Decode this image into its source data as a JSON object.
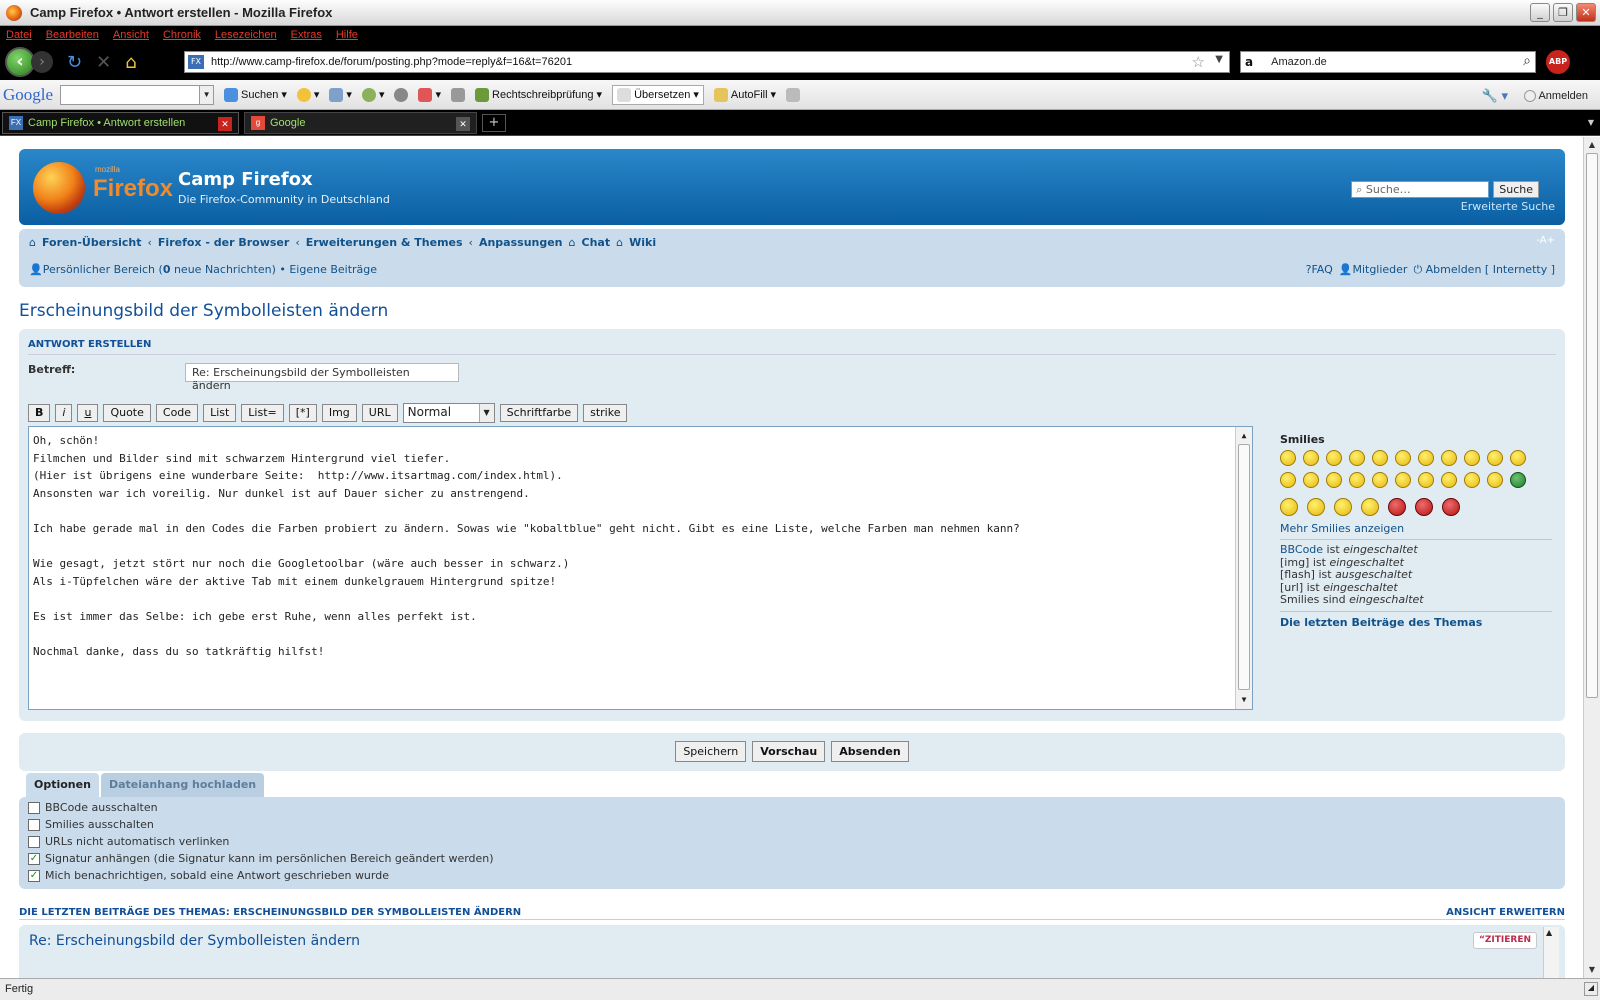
{
  "window": {
    "title": "Camp Firefox • Antwort erstellen - Mozilla Firefox"
  },
  "menu": [
    "Datei",
    "Bearbeiten",
    "Ansicht",
    "Chronik",
    "Lesezeichen",
    "Extras",
    "Hilfe"
  ],
  "nav": {
    "url": "http://www.camp-firefox.de/forum/posting.php?mode=reply&f=16&t=76201",
    "search_engine": "a",
    "search_text": "Amazon.de",
    "abp": "ABP"
  },
  "google_toolbar": {
    "logo": "Google",
    "items": [
      "Suchen",
      "Rechtschreibprüfung",
      "Übersetzen",
      "AutoFill"
    ],
    "right": [
      "Anmelden"
    ]
  },
  "tabs": [
    {
      "label": "Camp Firefox • Antwort erstellen",
      "active": true
    },
    {
      "label": "Google",
      "active": false
    }
  ],
  "header": {
    "logo_small": "mozilla",
    "logo_word": "Firefox",
    "title": "Camp Firefox",
    "description": "Die Firefox-Community in Deutschland",
    "search_placeholder": "Suche…",
    "search_button": "Suche",
    "advanced": "Erweiterte Suche"
  },
  "breadcrumbs": [
    "Foren-Übersicht",
    "Firefox - der Browser",
    "Erweiterungen & Themes",
    "Anpassungen",
    "Chat",
    "Wiki"
  ],
  "fontsize": "-A+",
  "navline": {
    "personal": "Persönlicher Bereich (",
    "count": "0",
    "rest": " neue Nachrichten)",
    "own": "• Eigene Beiträge"
  },
  "navright": [
    "FAQ",
    "Mitglieder",
    "Abmelden [ Internetty ]"
  ],
  "page_title": "Erscheinungsbild der Symbolleisten ändern",
  "form": {
    "heading": "Antwort erstellen",
    "subject_label": "Betreff:",
    "subject_value": "Re: Erscheinungsbild der Symbolleisten ändern",
    "toolbar": [
      "B",
      "i",
      "u",
      "Quote",
      "Code",
      "List",
      "List=",
      "[*]",
      "Img",
      "URL"
    ],
    "font_size": "Normal",
    "toolbar2": [
      "Schriftfarbe",
      "strike"
    ],
    "message_lines": [
      "Oh, schön!",
      "Filmchen und Bilder sind mit schwarzem Hintergrund viel tiefer.",
      "(Hier ist übrigens eine wunderbare Seite:  http://www.itsartmag.com/index.html).",
      "Ansonsten war ich voreilig. Nur dunkel ist auf Dauer sicher zu anstrengend.",
      "",
      "Ich habe gerade mal in den Codes die Farben probiert zu ändern. Sowas wie \"kobaltblue\" geht nicht. Gibt es eine Liste, welche Farben man nehmen kann?",
      "",
      "Wie gesagt, jetzt stört nur noch die Googletoolbar (wäre auch besser in schwarz.)",
      "Als i-Tüpfelchen wäre der aktive Tab mit einem dunkelgrauem Hintergrund spitze!",
      "",
      "Es ist immer das Selbe: ich gebe erst Ruhe, wenn alles perfekt ist.",
      "",
      "Nochmal danke, dass du so tatkräftig hilfst!"
    ]
  },
  "sidebar": {
    "smilies_title": "Smilies",
    "more": "Mehr Smilies anzeigen",
    "bbcode_link": "BBCode",
    "bbcode_rest": " ist ",
    "bbcode_state": "eingeschaltet",
    "img": "[img] ist ",
    "img_state": "eingeschaltet",
    "flash": "[flash] ist ",
    "flash_state": "ausgeschaltet",
    "url": "[url] ist ",
    "url_state": "eingeschaltet",
    "smilies": "Smilies sind ",
    "smilies_state": "eingeschaltet",
    "last": "Die letzten Beiträge des Themas"
  },
  "buttons": {
    "save": "Speichern",
    "preview": "Vorschau",
    "submit": "Absenden"
  },
  "options_tabs": [
    "Optionen",
    "Dateianhang hochladen"
  ],
  "options": [
    {
      "label": "BBCode ausschalten",
      "checked": false
    },
    {
      "label": "Smilies ausschalten",
      "checked": false
    },
    {
      "label": "URLs nicht automatisch verlinken",
      "checked": false
    },
    {
      "label": "Signatur anhängen (die Signatur kann im persönlichen Bereich geändert werden)",
      "checked": true
    },
    {
      "label": "Mich benachrichtigen, sobald eine Antwort geschrieben wurde",
      "checked": true
    }
  ],
  "last_posts": {
    "heading": "Die letzten Beiträge des Themas: Erscheinungsbild der Symbolleisten ändern",
    "expand": "Ansicht erweitern",
    "post_title": "Re: Erscheinungsbild der Symbolleisten ändern",
    "quote": "ZITIEREN"
  },
  "status": "Fertig"
}
